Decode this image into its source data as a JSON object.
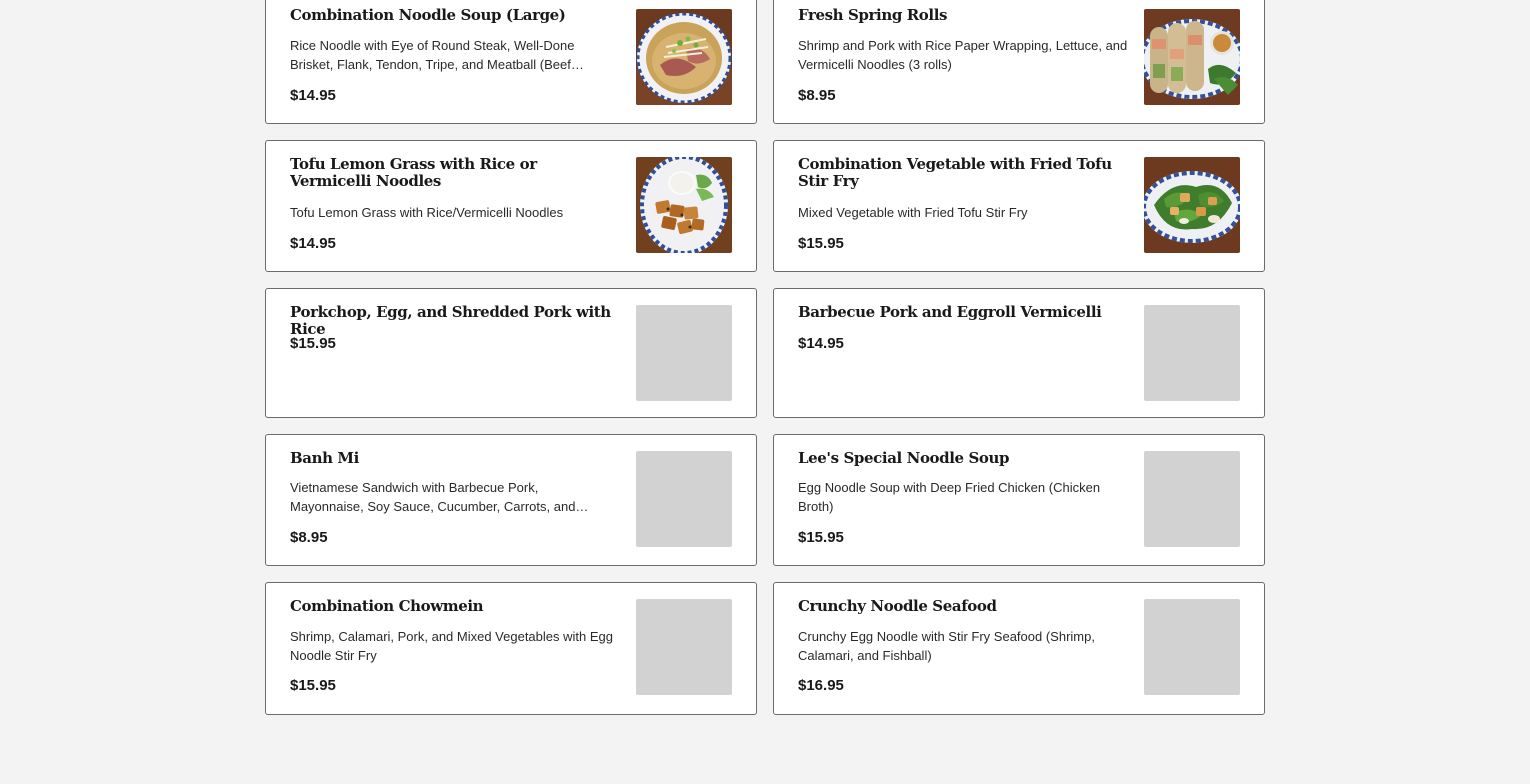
{
  "menu": {
    "items": [
      {
        "name": "Combination Noodle Soup (Large)",
        "description": "Rice Noodle with Eye of Round Steak, Well-Done Brisket, Flank, Tendon, Tripe, and Meatball (Beef…",
        "price": "$14.95",
        "image": "pho-bowl-photo"
      },
      {
        "name": "Fresh Spring Rolls",
        "description": "Shrimp and Pork with Rice Paper Wrapping, Lettuce, and Vermicelli Noodles (3 rolls)",
        "price": "$8.95",
        "image": "spring-rolls-photo"
      },
      {
        "name": "Tofu Lemon Grass with Rice or Vermicelli Noodles",
        "description": "Tofu Lemon Grass with Rice/Vermicelli Noodles",
        "price": "$14.95",
        "image": "tofu-rice-photo"
      },
      {
        "name": "Combination Vegetable with Fried Tofu Stir Fry",
        "description": "Mixed Vegetable with Fried Tofu Stir Fry",
        "price": "$15.95",
        "image": "vegetable-stir-fry-photo"
      },
      {
        "name": "Porkchop, Egg, and Shredded Pork with Rice",
        "description": "",
        "price": "$15.95",
        "image": "placeholder"
      },
      {
        "name": "Barbecue Pork and Eggroll Vermicelli",
        "description": "",
        "price": "$14.95",
        "image": "placeholder"
      },
      {
        "name": "Banh Mi",
        "description": "Vietnamese Sandwich with Barbecue Pork, Mayonnaise, Soy Sauce, Cucumber, Carrots, and…",
        "price": "$8.95",
        "image": "placeholder"
      },
      {
        "name": "Lee's Special Noodle Soup",
        "description": "Egg Noodle Soup with Deep Fried Chicken (Chicken Broth)",
        "price": "$15.95",
        "image": "placeholder"
      },
      {
        "name": "Combination Chowmein",
        "description": "Shrimp, Calamari, Pork, and Mixed Vegetables with Egg Noodle Stir Fry",
        "price": "$15.95",
        "image": "placeholder"
      },
      {
        "name": "Crunchy Noodle Seafood",
        "description": "Crunchy Egg Noodle with Stir Fry Seafood (Shrimp, Calamari, and Fishball)",
        "price": "$16.95",
        "image": "placeholder"
      }
    ]
  },
  "colors": {
    "background": "#f3f3f3",
    "card": "#ffffff",
    "card_border": "#6b6b6b",
    "placeholder": "#d2d2d2"
  }
}
